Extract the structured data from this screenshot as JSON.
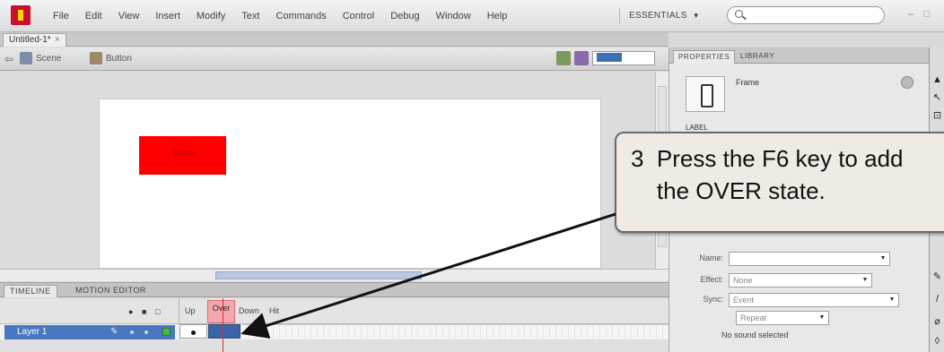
{
  "menu": {
    "items": [
      "File",
      "Edit",
      "View",
      "Insert",
      "Modify",
      "Text",
      "Commands",
      "Control",
      "Debug",
      "Window",
      "Help"
    ],
    "workspace": "ESSENTIALS",
    "search_placeholder": ""
  },
  "document_tab": {
    "label": "Untitled-1*",
    "close": "×"
  },
  "edit_bar": {
    "scene_label": "Scene",
    "symbol_label": "Button"
  },
  "stage": {
    "button_text": "Button"
  },
  "timeline": {
    "tabs": [
      "TIMELINE",
      "MOTION EDITOR"
    ],
    "frame_labels": [
      "Up",
      "Over",
      "Down",
      "Hit"
    ],
    "layer_name": "Layer 1"
  },
  "properties_panel": {
    "tabs": [
      "PROPERTIES",
      "LIBRARY"
    ],
    "symbol_type": "Frame",
    "label_heading": "LABEL",
    "name_label": "Name:",
    "name_value": "",
    "effect_label": "Effect:",
    "effect_value": "None",
    "sync_label": "Sync:",
    "sync_value": "Event",
    "repeat_value": "Repeat",
    "no_sound": "No sound selected"
  },
  "callout": {
    "text": "3  Press the F6 key to add\n    the OVER state."
  },
  "colors": {
    "accent_red": "#ff0000",
    "over_frame": "#f3a8ae",
    "selected_layer": "#4a78c0"
  }
}
